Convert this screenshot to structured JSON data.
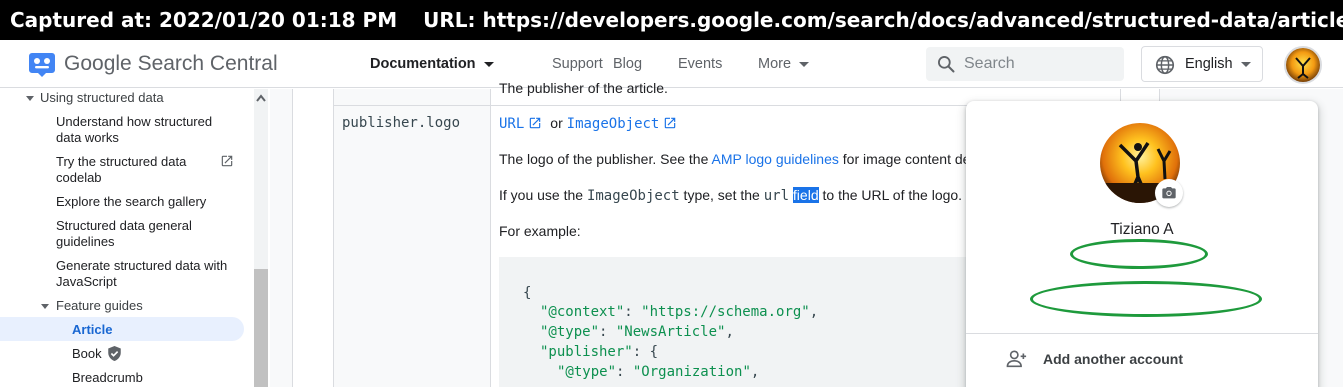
{
  "capture": {
    "captured_at": "Captured at: 2022/01/20 01:18 PM",
    "url": "URL: https://developers.google.com/search/docs/advanced/structured-data/article"
  },
  "header": {
    "brand_google": "Google",
    "brand_product": "Search Central",
    "nav": {
      "documentation": "Documentation",
      "support": "Support",
      "blog": "Blog",
      "events": "Events",
      "more": "More"
    },
    "search_placeholder": "Search",
    "language": "English"
  },
  "sidebar": {
    "section": "Using structured data",
    "items": [
      "Understand how structured",
      "data works",
      "Try the structured data",
      "codelab",
      "Explore the search gallery",
      "Structured data general",
      "guidelines",
      "Generate structured data with",
      "JavaScript"
    ],
    "feature_guides": "Feature guides",
    "article": "Article",
    "book": "Book",
    "breadcrumb": "Breadcrumb"
  },
  "content": {
    "previous_row_text": "The publisher of the article.",
    "property": "publisher.logo",
    "type_url": "URL",
    "type_or": "or",
    "type_imageobject": "ImageObject",
    "para1_before": "The logo of the publisher. See the ",
    "para1_link": "AMP logo guidelines",
    "para1_after": " for image content de",
    "para2_a": "If you use the ",
    "para2_code1": "ImageObject",
    "para2_b": " type, set the ",
    "para2_code2": "url",
    "para2_highlight": "field",
    "para2_c": " to the URL of the logo.",
    "para3": "For example:",
    "code": {
      "open": "{",
      "context_key": "\"@context\"",
      "context_val": "\"https://schema.org\"",
      "type_key": "\"@type\"",
      "type_val": "\"NewsArticle\"",
      "publisher_key": "\"publisher\"",
      "pub_type_key": "\"@type\"",
      "pub_type_val": "\"Organization\""
    }
  },
  "account_popup": {
    "name": "Tiziano A",
    "add_account": "Add another account"
  },
  "colors": {
    "accent": "#1a73e8",
    "active_bg": "#e8f0fe",
    "redaction": "#1e9a3c"
  }
}
